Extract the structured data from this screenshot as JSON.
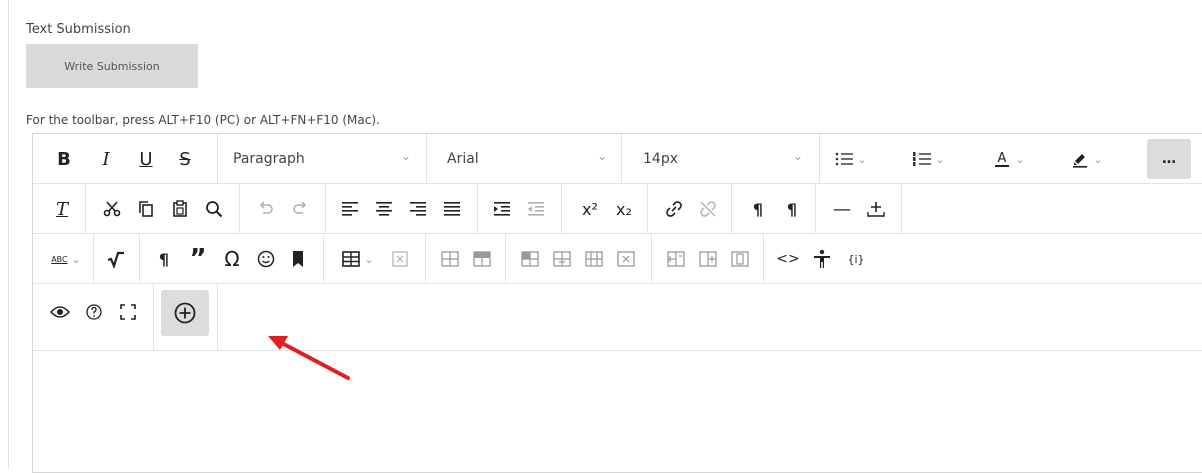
{
  "submission": {
    "label": "Text Submission",
    "write_button": "Write Submission"
  },
  "toolbar_hint": "For the toolbar, press ALT+F10 (PC) or ALT+FN+F10 (Mac).",
  "toolbar": {
    "row1": {
      "bold": "B",
      "italic": "I",
      "underline": "U",
      "strikethrough": "S",
      "paragraph_select": "Paragraph",
      "font_select": "Arial",
      "size_select": "14px",
      "more_label": "…"
    },
    "row2": {
      "clear_format": "T",
      "superscript": "x²",
      "subscript": "x₂",
      "rtl": "¶",
      "ltr": "¶",
      "hr": "—"
    },
    "row3": {
      "spellcheck": "ABC",
      "pilcrow": "¶",
      "quote": "”",
      "omega": "Ω",
      "code": "<>",
      "formula": "{i}"
    }
  },
  "colors": {
    "arrow": "#e02020",
    "button_gray": "#d9d9d9",
    "active_bg": "#dcdcdc"
  }
}
